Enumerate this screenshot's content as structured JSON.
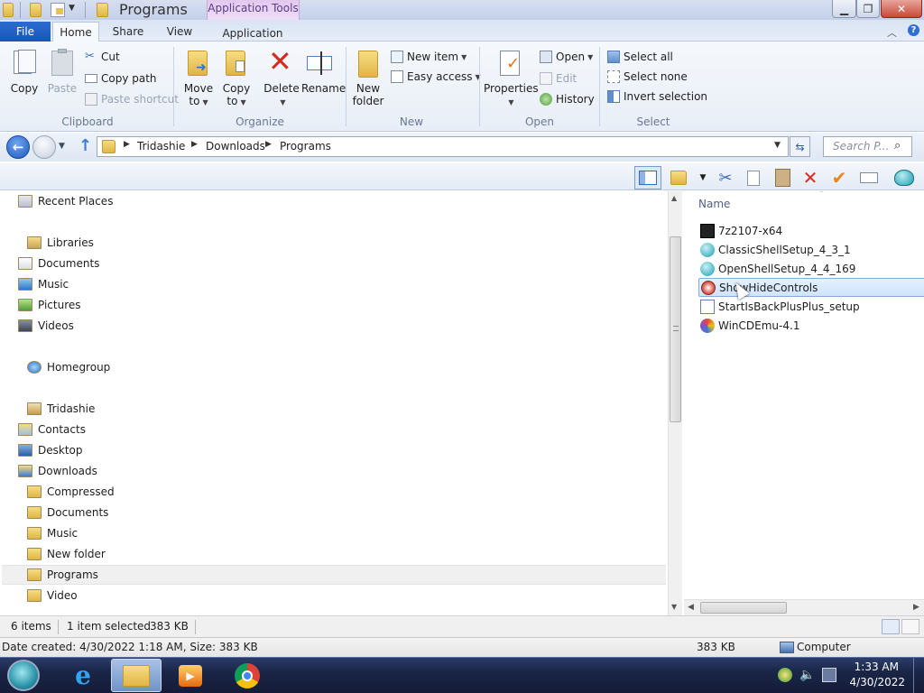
{
  "window": {
    "title": "Programs",
    "contextual_tab_group": "Application Tools",
    "minimize_glyph": "▁",
    "maximize_glyph": "❐",
    "close_glyph": "✕"
  },
  "ribbon": {
    "file_tab": "File",
    "tabs": [
      "Home",
      "Share",
      "View",
      "Application"
    ],
    "active_tab": "Home",
    "clipboard": {
      "copy": "Copy",
      "paste": "Paste",
      "cut": "Cut",
      "copy_path": "Copy path",
      "paste_shortcut": "Paste shortcut",
      "label": "Clipboard"
    },
    "organize": {
      "move_to_1": "Move",
      "move_to_2": "to",
      "copy_to_1": "Copy",
      "copy_to_2": "to",
      "delete": "Delete",
      "rename": "Rename",
      "label": "Organize"
    },
    "new": {
      "new_folder_1": "New",
      "new_folder_2": "folder",
      "new_item": "New item",
      "easy_access": "Easy access",
      "label": "New"
    },
    "open": {
      "properties": "Properties",
      "open": "Open",
      "edit": "Edit",
      "history": "History",
      "label": "Open"
    },
    "select": {
      "select_all": "Select all",
      "select_none": "Select none",
      "invert_selection": "Invert selection",
      "label": "Select"
    }
  },
  "address": {
    "breadcrumb": [
      "Tridashie",
      "Downloads",
      "Programs"
    ],
    "search_placeholder": "Search P..."
  },
  "nav": {
    "items": [
      {
        "label": "Recent Places",
        "icon": "recent-places-icon",
        "indent": 1
      },
      {
        "label": "Libraries",
        "icon": "libraries-icon",
        "indent": 0
      },
      {
        "label": "Documents",
        "icon": "documents-library-icon",
        "indent": 1
      },
      {
        "label": "Music",
        "icon": "music-library-icon",
        "indent": 1
      },
      {
        "label": "Pictures",
        "icon": "pictures-library-icon",
        "indent": 1
      },
      {
        "label": "Videos",
        "icon": "videos-library-icon",
        "indent": 1
      },
      {
        "label": "Homegroup",
        "icon": "homegroup-icon",
        "indent": 0
      },
      {
        "label": "Tridashie",
        "icon": "user-folder-icon",
        "indent": 0
      },
      {
        "label": "Contacts",
        "icon": "contacts-folder-icon",
        "indent": 1
      },
      {
        "label": "Desktop",
        "icon": "desktop-folder-icon",
        "indent": 1
      },
      {
        "label": "Downloads",
        "icon": "downloads-folder-icon",
        "indent": 1
      },
      {
        "label": "Compressed",
        "icon": "folder-icon",
        "indent": 2
      },
      {
        "label": "Documents",
        "icon": "folder-icon",
        "indent": 2
      },
      {
        "label": "Music",
        "icon": "folder-icon",
        "indent": 2
      },
      {
        "label": "New folder",
        "icon": "folder-icon",
        "indent": 2
      },
      {
        "label": "Programs",
        "icon": "folder-icon",
        "indent": 2,
        "selected": true
      },
      {
        "label": "Video",
        "icon": "folder-icon",
        "indent": 2
      }
    ]
  },
  "files": {
    "column_name": "Name",
    "items": [
      {
        "name": "7z2107-x64",
        "icon": "7zip-installer-icon"
      },
      {
        "name": "ClassicShellSetup_4_3_1",
        "icon": "classic-shell-icon"
      },
      {
        "name": "OpenShellSetup_4_4_169",
        "icon": "open-shell-icon"
      },
      {
        "name": "ShowHideControls",
        "icon": "showhidecontrols-icon",
        "selected": true
      },
      {
        "name": "StartIsBackPlusPlus_setup",
        "icon": "startisback-installer-icon"
      },
      {
        "name": "WinCDEmu-4.1",
        "icon": "wincdemu-icon"
      }
    ]
  },
  "status": {
    "item_count": "6 items",
    "selection": "1 item selected",
    "selection_size": "383 KB",
    "details": "Date created: 4/30/2022 1:18 AM, Size: 383 KB",
    "size": "383 KB",
    "location": "Computer"
  },
  "taskbar": {
    "time": "1:33 AM",
    "date": "4/30/2022"
  },
  "colors": {
    "file_tab": "#1a56b8",
    "selection_fill": "#cfe4fb",
    "selection_border": "#84acdd",
    "delete_red": "#d42b1e",
    "taskbar": "#1a2547"
  }
}
